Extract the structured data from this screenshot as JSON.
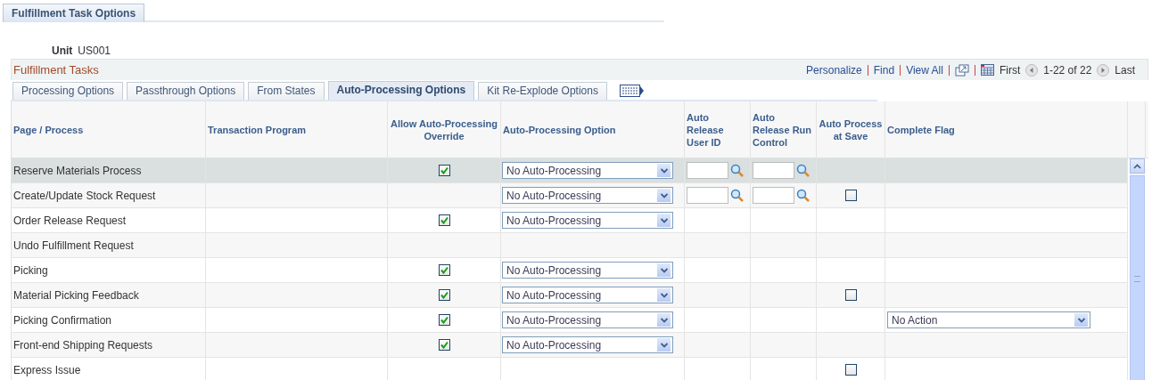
{
  "page_tab": {
    "label": "Fulfillment Task Options",
    "selected": true
  },
  "unit": {
    "label": "Unit",
    "value": "US001"
  },
  "grid": {
    "title": "Fulfillment Tasks",
    "toolbar_links": [
      "Personalize",
      "Find",
      "View All"
    ],
    "pager": {
      "first": "First",
      "range": "1-22 of 22",
      "last": "Last"
    },
    "tabs": [
      {
        "label": "Processing Options",
        "selected": false
      },
      {
        "label": "Passthrough Options",
        "selected": false
      },
      {
        "label": "From States",
        "selected": false
      },
      {
        "label": "Auto-Processing Options",
        "selected": true
      },
      {
        "label": "Kit Re-Explode Options",
        "selected": false
      }
    ],
    "columns": [
      "Page / Process",
      "Transaction Program",
      "Allow Auto-Processing Override",
      "Auto-Processing Option",
      "Auto Release User ID",
      "Auto Release Run Control",
      "Auto Process at Save",
      "Complete Flag"
    ],
    "rows": [
      {
        "process": "Reserve Materials Process",
        "selected": true,
        "allow_override": true,
        "option": "No Auto-Processing",
        "user_id_field": true,
        "run_control_field": true
      },
      {
        "process": "Create/Update Stock Request",
        "selected": false,
        "option": "No Auto-Processing",
        "user_id_field": true,
        "run_control_field": true,
        "auto_save": false
      },
      {
        "process": "Order Release Request",
        "selected": false,
        "allow_override": true,
        "option": "No Auto-Processing"
      },
      {
        "process": "Undo Fulfillment Request",
        "selected": false
      },
      {
        "process": "Picking",
        "selected": false,
        "allow_override": true,
        "option": "No Auto-Processing"
      },
      {
        "process": "Material Picking Feedback",
        "selected": false,
        "allow_override": true,
        "option": "No Auto-Processing",
        "auto_save": false
      },
      {
        "process": "Picking Confirmation",
        "selected": false,
        "allow_override": true,
        "option": "No Auto-Processing",
        "complete_flag": "No Action"
      },
      {
        "process": "Front-end Shipping Requests",
        "selected": false,
        "allow_override": true,
        "option": "No Auto-Processing"
      },
      {
        "process": "Express Issue",
        "selected": false,
        "auto_save": false
      }
    ]
  }
}
